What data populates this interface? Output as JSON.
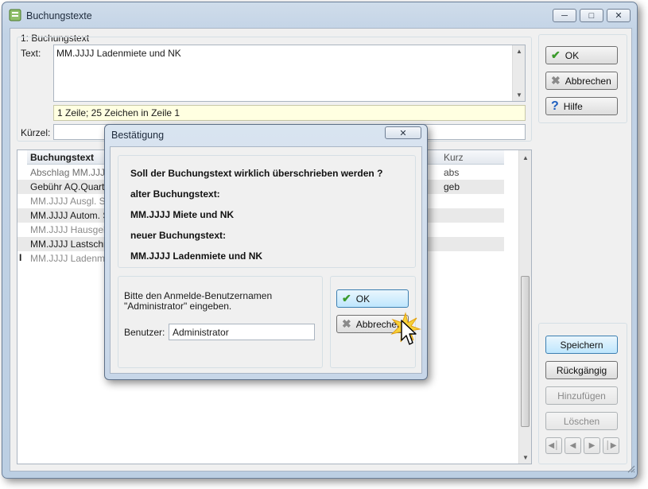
{
  "window": {
    "title": "Buchungstexte"
  },
  "form": {
    "group_label": "1: Buchungstext",
    "text_label": "Text:",
    "text_value": "MM.JJJJ Ladenmiete und NK",
    "status_line": "1 Zeile; 25 Zeichen in Zeile 1",
    "kuerzel_label": "Kürzel:",
    "kuerzel_value": ""
  },
  "side_buttons": {
    "ok": "OK",
    "abbrechen": "Abbrechen",
    "hilfe": "Hilfe"
  },
  "grid": {
    "col_text": "Buchungstext",
    "col_kurz": "Kurz",
    "rows": [
      {
        "text": "Abschlag MM.JJJJ",
        "kurz": "abs"
      },
      {
        "text": "Gebühr AQ.Quartal J",
        "kurz": "geb"
      },
      {
        "text": "MM.JJJJ Ausgl. Solls",
        "kurz": ""
      },
      {
        "text": "MM.JJJJ Autom. Solls",
        "kurz": ""
      },
      {
        "text": "MM.JJJJ Hausgeld",
        "kurz": ""
      },
      {
        "text": "MM.JJJJ Lastschrifte",
        "kurz": ""
      },
      {
        "text": "MM.JJJJ Ladenmiete",
        "kurz": ""
      }
    ]
  },
  "action_buttons": {
    "speichern": "Speichern",
    "rueckgaengig": "Rückgängig",
    "hinzufuegen": "Hinzufügen",
    "loeschen": "Löschen"
  },
  "dialog": {
    "title": "Bestätigung",
    "question": "Soll der Buchungstext wirklich überschrieben werden ?",
    "old_label": "alter Buchungstext:",
    "old_value": "MM.JJJJ Miete und NK",
    "new_label": "neuer Buchungstext:",
    "new_value": "MM.JJJJ Ladenmiete und NK",
    "prompt": "Bitte den Anmelde-Benutzernamen \"Administrator\" eingeben.",
    "user_label": "Benutzer:",
    "user_value": "Administrator",
    "ok": "OK",
    "abbrechen": "Abbrechen"
  },
  "colors": {
    "status_bg": "#ffffe1",
    "focus_border": "#3c7fb1",
    "ok_check": "#3a9a2a",
    "help_blue": "#1f5fbf"
  }
}
